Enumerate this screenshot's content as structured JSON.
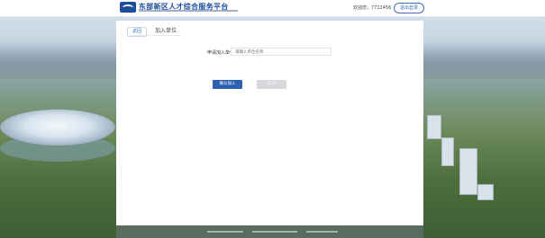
{
  "header": {
    "title": "东部新区人才综合服务平台",
    "welcome": "欢迎您，7712456",
    "logout_label": "退出登录"
  },
  "tabs": [
    {
      "label": "返回",
      "active": true
    },
    {
      "label": "加入单位",
      "active": false
    }
  ],
  "form": {
    "unit_label": "申请加入单位",
    "unit_placeholder": "请输入单位名称",
    "confirm_label": "确认加入",
    "cancel_label": "取消"
  },
  "colors": {
    "brand": "#1c4d9b",
    "primary_button": "#2d5fb3",
    "disabled_button": "#d6d8dc"
  }
}
